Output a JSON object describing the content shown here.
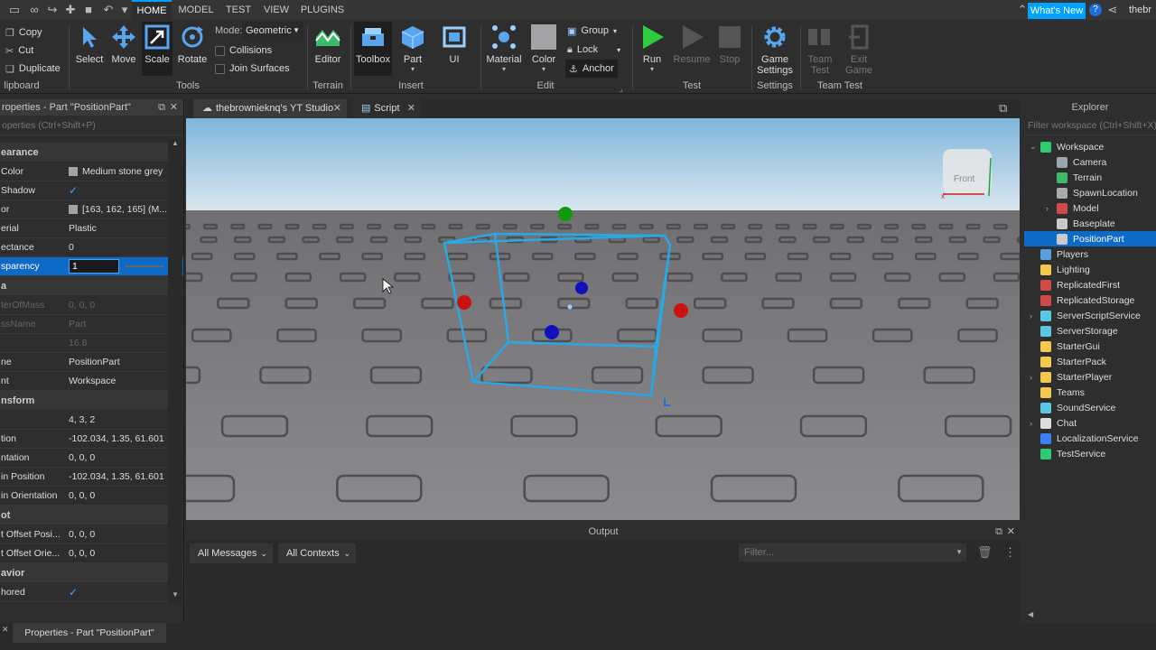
{
  "menu_tabs": [
    "HOME",
    "MODEL",
    "TEST",
    "VIEW",
    "PLUGINS"
  ],
  "whats_new": "What's New",
  "user_name": "thebr",
  "clipboard": {
    "copy": "Copy",
    "cut": "Cut",
    "duplicate": "Duplicate",
    "group": "lipboard"
  },
  "tools": {
    "select": "Select",
    "move": "Move",
    "scale": "Scale",
    "rotate": "Rotate",
    "mode_label": "Mode:",
    "mode_value": "Geometric",
    "collisions": "Collisions",
    "join_surfaces": "Join Surfaces",
    "group": "Tools"
  },
  "terrain": {
    "editor": "Editor",
    "group": "Terrain"
  },
  "insert": {
    "toolbox": "Toolbox",
    "part": "Part",
    "ui": "UI",
    "group": "Insert"
  },
  "edit": {
    "material": "Material",
    "color": "Color",
    "group_btn": "Group",
    "lock": "Lock",
    "anchor": "Anchor",
    "group": "Edit"
  },
  "test": {
    "run": "Run",
    "resume": "Resume",
    "stop": "Stop",
    "group": "Test"
  },
  "settings": {
    "game_settings_1": "Game",
    "game_settings_2": "Settings",
    "group": "Settings"
  },
  "team_test": {
    "team_test_1": "Team",
    "team_test_2": "Test",
    "exit_game_1": "Exit",
    "exit_game_2": "Game",
    "group": "Team Test"
  },
  "properties": {
    "title": "roperties - Part \"PositionPart\"",
    "filter": "operties (Ctrl+Shift+P)",
    "categories": {
      "appearance": "earance",
      "data": "a",
      "transform": "nsform",
      "pivot": "ot",
      "behavior": "avior"
    },
    "appearance": [
      {
        "k": "Color",
        "v": "Medium stone grey"
      },
      {
        "k": "Shadow",
        "v": ""
      },
      {
        "k": "or",
        "v": "[163, 162, 165] (M..."
      },
      {
        "k": "erial",
        "v": "Plastic"
      },
      {
        "k": "ectance",
        "v": "0"
      },
      {
        "k": "sparency",
        "v": "1"
      }
    ],
    "data": [
      {
        "k": "terOfMass",
        "v": "0, 0, 0"
      },
      {
        "k": "ssName",
        "v": "Part"
      },
      {
        "k": "",
        "v": "16.8"
      },
      {
        "k": "ne",
        "v": "PositionPart"
      },
      {
        "k": "nt",
        "v": "Workspace"
      }
    ],
    "transform": [
      {
        "k": "",
        "v": "4, 3, 2"
      },
      {
        "k": "tion",
        "v": "-102.034, 1.35, 61.601"
      },
      {
        "k": "ntation",
        "v": "0, 0, 0"
      },
      {
        "k": "in Position",
        "v": "-102.034, 1.35, 61.601"
      },
      {
        "k": "in Orientation",
        "v": "0, 0, 0"
      }
    ],
    "pivot": [
      {
        "k": "t Offset Posi...",
        "v": "0, 0, 0"
      },
      {
        "k": "t Offset Orie...",
        "v": "0, 0, 0"
      }
    ],
    "behavior": [
      {
        "k": "hored",
        "v": ""
      }
    ],
    "footer_tab": "Properties - Part \"PositionPart\""
  },
  "doc_tabs": [
    "thebrownieknq's YT Studio",
    "Script"
  ],
  "viewcube_label": "Front",
  "output": {
    "title": "Output",
    "messages": "All Messages",
    "contexts": "All Contexts",
    "filter_placeholder": "Filter..."
  },
  "explorer": {
    "title": "Explorer",
    "filter": "Filter workspace (Ctrl+Shift+X)",
    "items": [
      {
        "label": "Workspace",
        "indent": 0,
        "arrow": "v",
        "color": "#2ecc71"
      },
      {
        "label": "Camera",
        "indent": 1,
        "arrow": "",
        "color": "#9aa5b1"
      },
      {
        "label": "Terrain",
        "indent": 1,
        "arrow": "",
        "color": "#3dbb6b"
      },
      {
        "label": "SpawnLocation",
        "indent": 1,
        "arrow": "",
        "color": "#aaaaaa"
      },
      {
        "label": "Model",
        "indent": 1,
        "arrow": ">",
        "color": "#d04a4a"
      },
      {
        "label": "Baseplate",
        "indent": 1,
        "arrow": "",
        "color": "#c9c9c9"
      },
      {
        "label": "PositionPart",
        "indent": 1,
        "arrow": "",
        "color": "#c9c9c9",
        "selected": true
      },
      {
        "label": "Players",
        "indent": 0,
        "arrow": "",
        "color": "#5aa0e0"
      },
      {
        "label": "Lighting",
        "indent": 0,
        "arrow": "",
        "color": "#f2c94c"
      },
      {
        "label": "ReplicatedFirst",
        "indent": 0,
        "arrow": "",
        "color": "#d04a4a"
      },
      {
        "label": "ReplicatedStorage",
        "indent": 0,
        "arrow": "",
        "color": "#d04a4a"
      },
      {
        "label": "ServerScriptService",
        "indent": 0,
        "arrow": ">",
        "color": "#5ac8e0"
      },
      {
        "label": "ServerStorage",
        "indent": 0,
        "arrow": "",
        "color": "#5ac8e0"
      },
      {
        "label": "StarterGui",
        "indent": 0,
        "arrow": "",
        "color": "#f2c94c"
      },
      {
        "label": "StarterPack",
        "indent": 0,
        "arrow": "",
        "color": "#f2c94c"
      },
      {
        "label": "StarterPlayer",
        "indent": 0,
        "arrow": ">",
        "color": "#f2c94c"
      },
      {
        "label": "Teams",
        "indent": 0,
        "arrow": "",
        "color": "#f2c94c"
      },
      {
        "label": "SoundService",
        "indent": 0,
        "arrow": "",
        "color": "#5ac8e0"
      },
      {
        "label": "Chat",
        "indent": 0,
        "arrow": ">",
        "color": "#dddddd"
      },
      {
        "label": "LocalizationService",
        "indent": 0,
        "arrow": "",
        "color": "#3b82f6"
      },
      {
        "label": "TestService",
        "indent": 0,
        "arrow": "",
        "color": "#2ecc71"
      }
    ]
  },
  "colors": {
    "accent": "#00a2ff",
    "selection": "#0e6ac7",
    "bbox": "#29a8e6",
    "handle_red": "#cc1111",
    "handle_green": "#119911",
    "handle_blue": "#1111bb"
  }
}
